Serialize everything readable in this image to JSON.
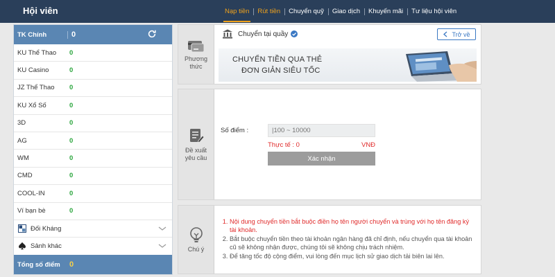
{
  "header": {
    "title": "Hội viên",
    "nav": [
      {
        "label": "Nạp tiền",
        "state": "active"
      },
      {
        "label": "Rút tiền",
        "state": "warn"
      },
      {
        "label": "Chuyển quỹ",
        "state": ""
      },
      {
        "label": "Giao dịch",
        "state": ""
      },
      {
        "label": "Khuyến mãi",
        "state": ""
      },
      {
        "label": "Tư liệu hội viên",
        "state": ""
      }
    ]
  },
  "sidebar": {
    "main_account": {
      "label": "TK Chính",
      "value": "0"
    },
    "rows": [
      {
        "name": "KU Thể Thao",
        "value": "0"
      },
      {
        "name": "KU Casino",
        "value": "0"
      },
      {
        "name": "JZ Thể Thao",
        "value": "0"
      },
      {
        "name": "KU Xổ Số",
        "value": "0"
      },
      {
        "name": "3D",
        "value": "0"
      },
      {
        "name": "AG",
        "value": "0"
      },
      {
        "name": "WM",
        "value": "0"
      },
      {
        "name": "CMD",
        "value": "0"
      },
      {
        "name": "COOL-IN",
        "value": "0"
      },
      {
        "name": "Ví bạn bè",
        "value": "0"
      }
    ],
    "groups": [
      {
        "label": "Đối Kháng",
        "icon": "grid-icon"
      },
      {
        "label": "Sảnh khác",
        "icon": "spade-icon"
      }
    ],
    "total": {
      "label": "Tổng số điểm",
      "value": "0"
    }
  },
  "method_panel": {
    "side_label_1": "Phương",
    "side_label_2": "thức",
    "method_title": "Chuyển tại quầy",
    "back_button": "Trở về",
    "banner_line1": "CHUYỂN TIỀN QUA THẺ",
    "banner_line2": "ĐƠN GIẢN SIÊU TỐC"
  },
  "request_panel": {
    "side_label_1": "Đề xuất",
    "side_label_2": "yêu cầu",
    "points_label": "Số điểm :",
    "points_placeholder": "|100 ~ 10000",
    "actual_label": "Thực tế : 0",
    "currency": "VNĐ",
    "confirm_button": "Xác nhận"
  },
  "notes_panel": {
    "side_label": "Chú ý",
    "notes": [
      "Nội dung chuyển tiền bắt buộc điền họ tên người chuyển và trùng với họ tên đăng ký tài khoản.",
      "Bắt buộc chuyển tiền theo tài khoản ngân hàng đã chỉ định, nếu chuyển qua tài khoản cũ sẽ không nhận được, chúng tôi sẽ không chịu trách nhiệm.",
      "Để tăng tốc độ cộng điểm, vui lòng đến mục lịch sử giao dịch tải biên lai lên."
    ]
  },
  "colors": {
    "header_bg": "#2a3f5a",
    "accent": "#f0a21c",
    "sidebar_blue": "#5a86b3",
    "positive": "#2aa53c",
    "warning_red": "#e02a2a"
  }
}
